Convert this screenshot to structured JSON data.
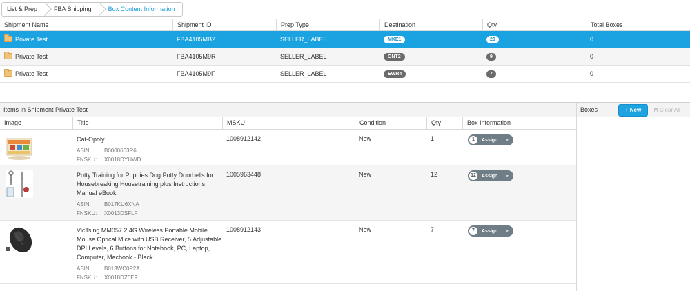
{
  "breadcrumb": [
    "List & Prep",
    "FBA Shipping",
    "Box Content Information"
  ],
  "shipments": {
    "columns": [
      "Shipment Name",
      "Shipment ID",
      "Prep Type",
      "Destination",
      "Qty",
      "Total Boxes"
    ],
    "rows": [
      {
        "name": "Private Test",
        "id": "FBA4105MB2",
        "prep": "SELLER_LABEL",
        "dest": "MKE1",
        "qty": "20",
        "boxes": "0",
        "selected": true
      },
      {
        "name": "Private Test",
        "id": "FBA4105M9R",
        "prep": "SELLER_LABEL",
        "dest": "ONT2",
        "qty": "9",
        "boxes": "0",
        "selected": false
      },
      {
        "name": "Private Test",
        "id": "FBA4105M9F",
        "prep": "SELLER_LABEL",
        "dest": "EWR4",
        "qty": "7",
        "boxes": "0",
        "selected": false
      }
    ]
  },
  "items": {
    "title": "Items In Shipment Private Test",
    "columns": [
      "Image",
      "Title",
      "MSKU",
      "Condition",
      "Qty",
      "Box Information"
    ],
    "asin_label": "ASIN:",
    "fnsku_label": "FNSKU:",
    "assign_label": "Assign",
    "rows": [
      {
        "title": "Cat-Opoly",
        "asin": "B0000663R6",
        "fnsku": "X0018DYUWD",
        "msku": "1008912142",
        "condition": "New",
        "qty": "1",
        "assign_count": "1"
      },
      {
        "title": "Potty Training for Puppies Dog Potty Doorbells for Housebreaking Housetraining plus Instructions Manual eBook",
        "asin": "B017KU6XNA",
        "fnsku": "X0013DSFLF",
        "msku": "1005963448",
        "condition": "New",
        "qty": "12",
        "assign_count": "12"
      },
      {
        "title": "VicTsing MM057 2.4G Wireless Portable Mobile Mouse Optical Mice with USB Receiver, 5 Adjustable DPI Levels, 6 Buttons for Notebook, PC, Laptop, Computer, Macbook - Black",
        "asin": "B013WC0P2A",
        "fnsku": "X0018DZ6E9",
        "msku": "1008912143",
        "condition": "New",
        "qty": "7",
        "assign_count": "7"
      }
    ]
  },
  "boxes": {
    "title": "Boxes",
    "new_label": "+ New",
    "clear_label": "Clear All"
  },
  "colors": {
    "accent": "#1aa3e0",
    "pill": "#6b6b6b",
    "assign": "#6f7d86"
  }
}
